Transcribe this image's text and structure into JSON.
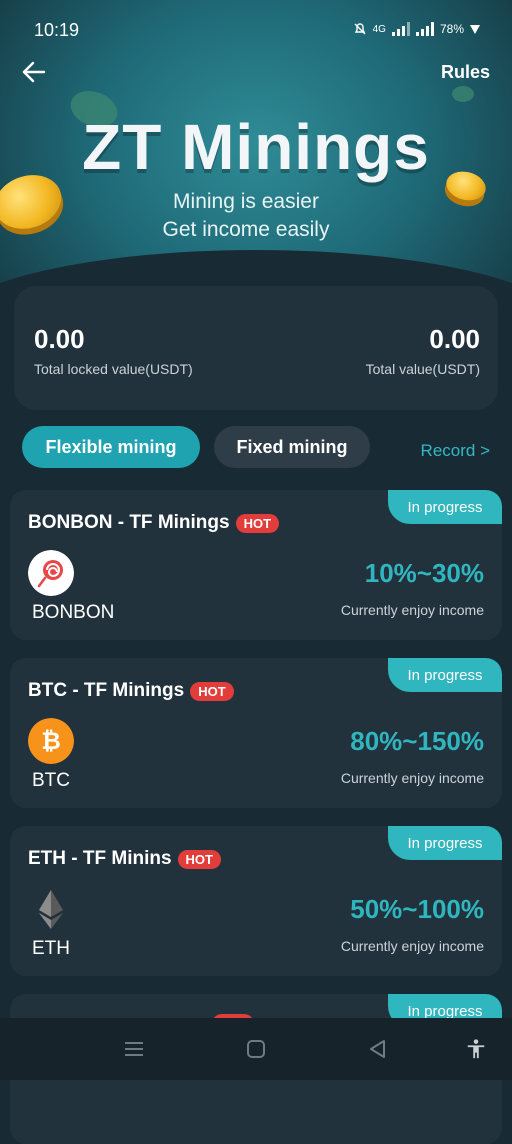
{
  "status": {
    "time": "10:19",
    "network": "4G",
    "battery": "78%"
  },
  "header": {
    "rules_label": "Rules"
  },
  "hero": {
    "title": "ZT Minings",
    "subtitle_1": "Mining is easier",
    "subtitle_2": "Get income easily"
  },
  "summary": {
    "locked_value": "0.00",
    "locked_label": "Total locked value(USDT)",
    "total_value": "0.00",
    "total_label": "Total value(USDT)"
  },
  "tabs": {
    "flexible": "Flexible mining",
    "fixed": "Fixed mining",
    "record": "Record >"
  },
  "cards": [
    {
      "title": "BONBON - TF Minings",
      "hot": "HOT",
      "status": "In progress",
      "coin": "BONBON",
      "rate": "10%~30%",
      "rate_label": "Currently enjoy income",
      "icon": "lollipop-icon"
    },
    {
      "title": "BTC - TF Minings",
      "hot": "HOT",
      "status": "In progress",
      "coin": "BTC",
      "rate": "80%~150%",
      "rate_label": "Currently enjoy income",
      "icon": "bitcoin-icon"
    },
    {
      "title": "ETH - TF Minins",
      "hot": "HOT",
      "status": "In progress",
      "coin": "ETH",
      "rate": "50%~100%",
      "rate_label": "Currently enjoy income",
      "icon": "ethereum-icon"
    },
    {
      "status": "In progress"
    }
  ],
  "colors": {
    "accent": "#2fb6bf",
    "hot": "#e23d3b",
    "background": "#182a34",
    "card": "#22323d"
  }
}
